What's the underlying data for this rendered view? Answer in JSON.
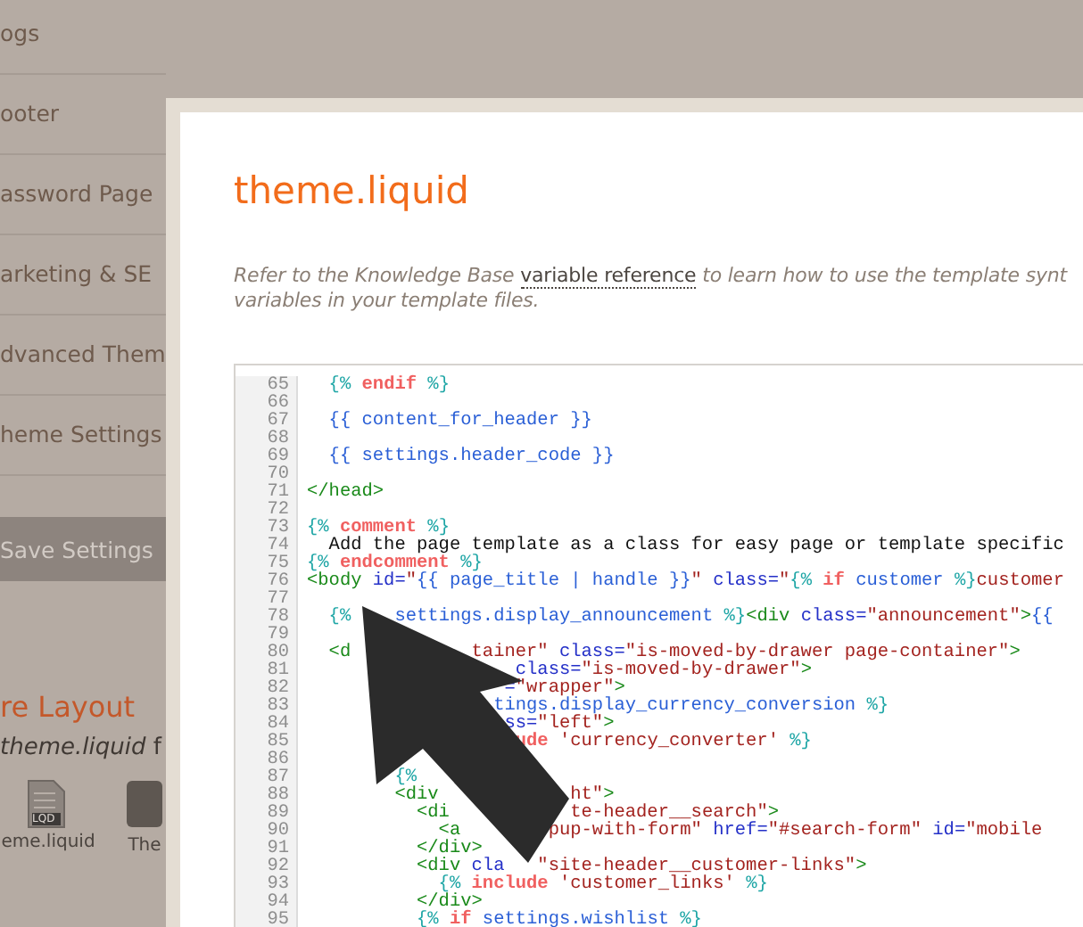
{
  "sidebar": {
    "items": [
      {
        "label": "ogs"
      },
      {
        "label": "ooter"
      },
      {
        "label": "assword Page"
      },
      {
        "label": "arketing & SE"
      },
      {
        "label": "dvanced Them"
      },
      {
        "label": "heme Settings"
      }
    ],
    "save_button": "Save Settings",
    "section_title": "re Layout",
    "section_text": "*theme.liquid* f",
    "files": [
      {
        "label": "eme.liquid",
        "badge": "LQD",
        "kind": "liquid"
      },
      {
        "label": "The",
        "kind": "dark"
      }
    ]
  },
  "dialog": {
    "title": "theme.liquid",
    "description": {
      "before": "Refer to the Knowledge Base ",
      "link": "variable reference",
      "after": " to learn how to use the template synt",
      "line2": "variables in your template files."
    },
    "code_lines": [
      {
        "num": "65",
        "segments": [
          {
            "kind": "delim",
            "text": "  {% "
          },
          {
            "kind": "keyword",
            "text": "endif"
          },
          {
            "kind": "delim",
            "text": " %}"
          }
        ]
      },
      {
        "num": "66"
      },
      {
        "num": "67",
        "segments": [
          {
            "kind": "var",
            "text": "  {{ content_for_header }}"
          }
        ]
      },
      {
        "num": "68"
      },
      {
        "num": "69",
        "segments": [
          {
            "kind": "var",
            "text": "  {{ settings.header_code }}"
          }
        ]
      },
      {
        "num": "70"
      },
      {
        "num": "71",
        "segments": [
          {
            "kind": "tag",
            "text": "</head>"
          }
        ]
      },
      {
        "num": "72"
      },
      {
        "num": "73",
        "segments": [
          {
            "kind": "delim",
            "text": "{% "
          },
          {
            "kind": "keyword",
            "text": "comment"
          },
          {
            "kind": "delim",
            "text": " %}"
          }
        ]
      },
      {
        "num": "74",
        "segments": [
          {
            "kind": "plain",
            "text": "  Add the page template as a class for easy page or template specific"
          }
        ]
      },
      {
        "num": "75",
        "segments": [
          {
            "kind": "delim",
            "text": "{% "
          },
          {
            "kind": "keyword",
            "text": "endcomment"
          },
          {
            "kind": "delim",
            "text": " %}"
          }
        ]
      },
      {
        "num": "76",
        "segments": [
          {
            "kind": "tag",
            "text": "<body "
          },
          {
            "kind": "attr",
            "text": "id="
          },
          {
            "kind": "string",
            "text": "\""
          },
          {
            "kind": "var",
            "text": "{{ page_title | handle }}"
          },
          {
            "kind": "string",
            "text": "\" "
          },
          {
            "kind": "attr",
            "text": "class="
          },
          {
            "kind": "string",
            "text": "\""
          },
          {
            "kind": "delim",
            "text": "{% "
          },
          {
            "kind": "keyword",
            "text": "if"
          },
          {
            "kind": "var",
            "text": " customer "
          },
          {
            "kind": "delim",
            "text": "%}"
          },
          {
            "kind": "string",
            "text": "customer"
          }
        ]
      },
      {
        "num": "77"
      },
      {
        "num": "78",
        "segments": [
          {
            "kind": "delim",
            "text": "  {%"
          },
          {
            "kind": "var",
            "text": "    settings.display_announcement "
          },
          {
            "kind": "delim",
            "text": "%}"
          },
          {
            "kind": "tag",
            "text": "<div "
          },
          {
            "kind": "attr",
            "text": "class="
          },
          {
            "kind": "string",
            "text": "\"announcement\""
          },
          {
            "kind": "tag",
            "text": ">"
          },
          {
            "kind": "var",
            "text": "{{"
          }
        ]
      },
      {
        "num": "79"
      },
      {
        "num": "80",
        "segments": [
          {
            "kind": "tag",
            "text": "  <d"
          },
          {
            "kind": "string",
            "text": "           tainer\" "
          },
          {
            "kind": "attr",
            "text": "class="
          },
          {
            "kind": "string",
            "text": "\"is-moved-by-drawer page-container\""
          },
          {
            "kind": "tag",
            "text": ">"
          }
        ]
      },
      {
        "num": "81",
        "segments": [
          {
            "kind": "attr",
            "text": "                   class="
          },
          {
            "kind": "string",
            "text": "\"is-moved-by-drawer\""
          },
          {
            "kind": "tag",
            "text": ">"
          }
        ]
      },
      {
        "num": "82",
        "segments": [
          {
            "kind": "attr",
            "text": "                  ="
          },
          {
            "kind": "string",
            "text": "\"wrapper\""
          },
          {
            "kind": "tag",
            "text": ">"
          }
        ]
      },
      {
        "num": "83",
        "segments": [
          {
            "kind": "var",
            "text": "                 tings.display_currency_conversion "
          },
          {
            "kind": "delim",
            "text": "%}"
          }
        ]
      },
      {
        "num": "84",
        "segments": [
          {
            "kind": "attr",
            "text": "                  ss="
          },
          {
            "kind": "string",
            "text": "\"left\""
          },
          {
            "kind": "tag",
            "text": ">"
          }
        ]
      },
      {
        "num": "85",
        "segments": [
          {
            "kind": "keyword",
            "text": "                   ude "
          },
          {
            "kind": "string",
            "text": "'currency_converter' "
          },
          {
            "kind": "delim",
            "text": "%}"
          }
        ]
      },
      {
        "num": "86"
      },
      {
        "num": "87",
        "segments": [
          {
            "kind": "delim",
            "text": "        {%"
          }
        ]
      },
      {
        "num": "88",
        "segments": [
          {
            "kind": "tag",
            "text": "        <div"
          },
          {
            "kind": "string",
            "text": "            ht\""
          },
          {
            "kind": "tag",
            "text": ">"
          }
        ]
      },
      {
        "num": "89",
        "segments": [
          {
            "kind": "tag",
            "text": "          <di"
          },
          {
            "kind": "string",
            "text": "           te-header__search\""
          },
          {
            "kind": "tag",
            "text": ">"
          }
        ]
      },
      {
        "num": "90",
        "segments": [
          {
            "kind": "tag",
            "text": "            <a"
          },
          {
            "kind": "string",
            "text": "        pup-with-form\" "
          },
          {
            "kind": "attr",
            "text": "href="
          },
          {
            "kind": "string",
            "text": "\"#search-form\" "
          },
          {
            "kind": "attr",
            "text": "id="
          },
          {
            "kind": "string",
            "text": "\"mobile"
          }
        ]
      },
      {
        "num": "91",
        "segments": [
          {
            "kind": "tag",
            "text": "          </div>"
          }
        ]
      },
      {
        "num": "92",
        "segments": [
          {
            "kind": "tag",
            "text": "          <div "
          },
          {
            "kind": "attr",
            "text": "cla"
          },
          {
            "kind": "string",
            "text": "   \"site-header__customer-links\""
          },
          {
            "kind": "tag",
            "text": ">"
          }
        ]
      },
      {
        "num": "93",
        "segments": [
          {
            "kind": "delim",
            "text": "            {% "
          },
          {
            "kind": "keyword",
            "text": "include "
          },
          {
            "kind": "string",
            "text": "'customer_links' "
          },
          {
            "kind": "delim",
            "text": "%}"
          }
        ]
      },
      {
        "num": "94",
        "segments": [
          {
            "kind": "tag",
            "text": "          </div>"
          }
        ]
      },
      {
        "num": "95",
        "segments": [
          {
            "kind": "delim",
            "text": "          {% "
          },
          {
            "kind": "keyword",
            "text": "if"
          },
          {
            "kind": "var",
            "text": " settings.wishlist "
          },
          {
            "kind": "delim",
            "text": "%}"
          }
        ]
      }
    ]
  }
}
